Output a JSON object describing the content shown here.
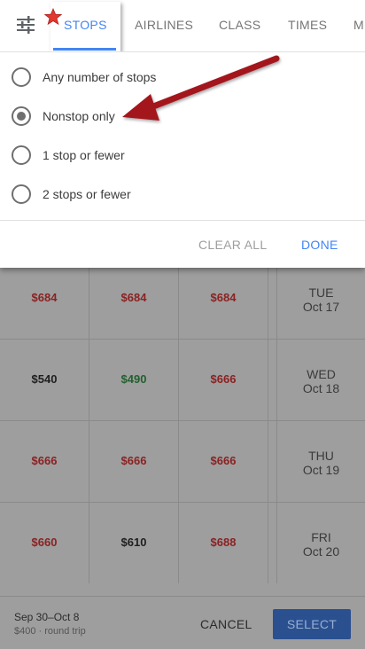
{
  "tabs": [
    {
      "label": "STOPS",
      "active": true
    },
    {
      "label": "AIRLINES",
      "active": false
    },
    {
      "label": "CLASS",
      "active": false
    },
    {
      "label": "TIMES",
      "active": false
    },
    {
      "label": "M",
      "active": false
    }
  ],
  "stop_options": [
    {
      "label": "Any number of stops",
      "selected": false
    },
    {
      "label": "Nonstop only",
      "selected": true
    },
    {
      "label": "1 stop or fewer",
      "selected": false
    },
    {
      "label": "2 stops or fewer",
      "selected": false
    }
  ],
  "actions": {
    "clear_all": "CLEAR ALL",
    "done": "DONE"
  },
  "price_rows": [
    {
      "prices": [
        {
          "value": "$684",
          "tone": "red"
        },
        {
          "value": "$684",
          "tone": "red"
        },
        {
          "value": "$684",
          "tone": "red"
        }
      ],
      "day": "TUE",
      "date": "Oct 17"
    },
    {
      "prices": [
        {
          "value": "$540",
          "tone": "black"
        },
        {
          "value": "$490",
          "tone": "green"
        },
        {
          "value": "$666",
          "tone": "red"
        }
      ],
      "day": "WED",
      "date": "Oct 18"
    },
    {
      "prices": [
        {
          "value": "$666",
          "tone": "red"
        },
        {
          "value": "$666",
          "tone": "red"
        },
        {
          "value": "$666",
          "tone": "red"
        }
      ],
      "day": "THU",
      "date": "Oct 19"
    },
    {
      "prices": [
        {
          "value": "$660",
          "tone": "red"
        },
        {
          "value": "$610",
          "tone": "black"
        },
        {
          "value": "$688",
          "tone": "red"
        }
      ],
      "day": "FRI",
      "date": "Oct 20"
    }
  ],
  "bottom_bar": {
    "dates": "Sep 30–Oct 8",
    "price": "$400 · round trip",
    "cancel": "CANCEL",
    "select": "SELECT"
  },
  "colors": {
    "accent": "#4285f4",
    "red_price": "#8b2222",
    "green_price": "#23602f",
    "arrow": "#a3141f"
  },
  "icons": [
    "filter-sliders-icon",
    "star-icon",
    "annotation-arrow"
  ]
}
